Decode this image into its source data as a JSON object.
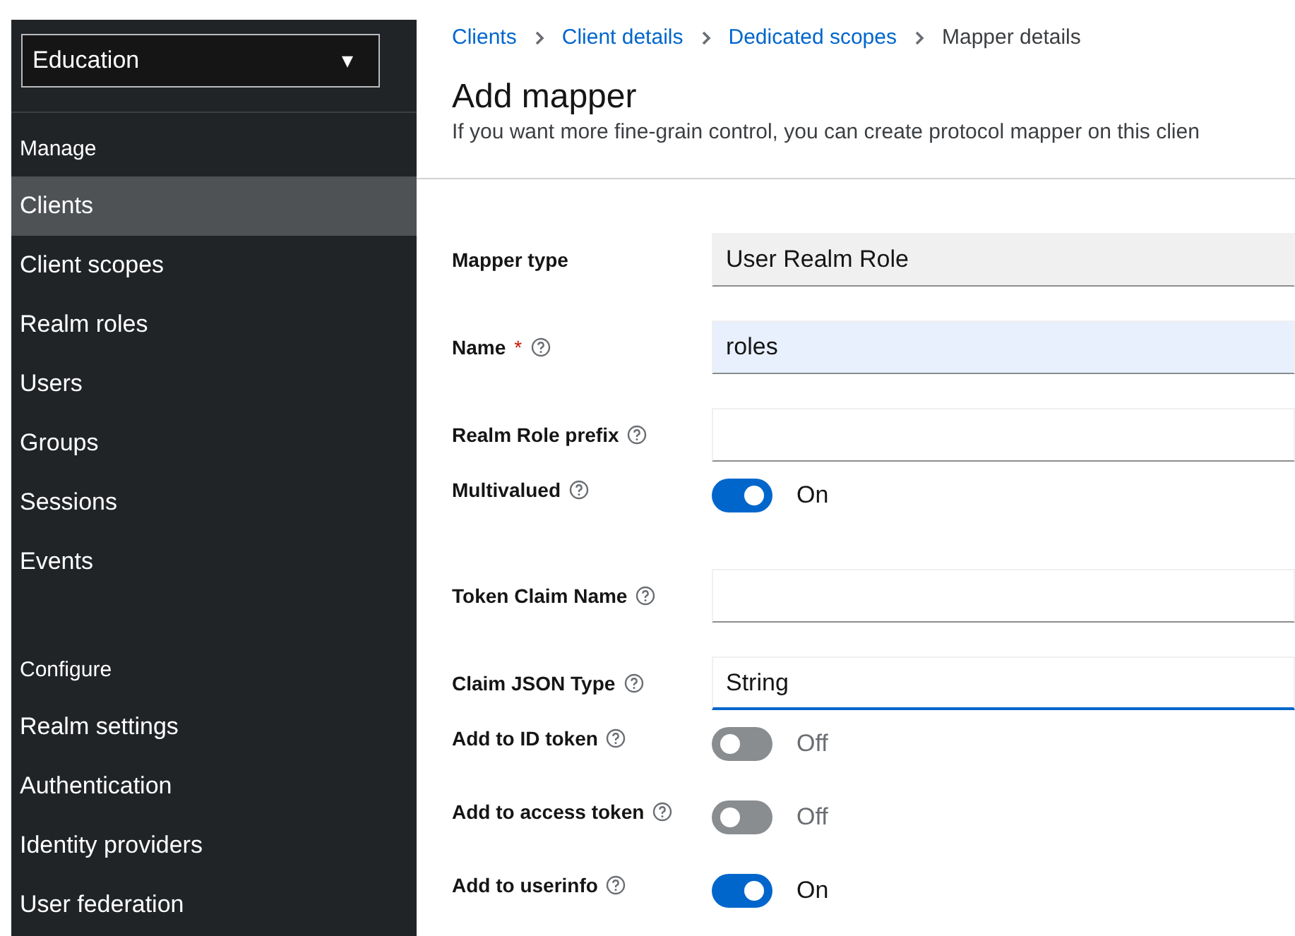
{
  "sidebar": {
    "realm_selector": {
      "value": "Education",
      "caret": "▾"
    },
    "sections": [
      {
        "title": "Manage",
        "items": [
          {
            "label": "Clients",
            "selected": true
          },
          {
            "label": "Client scopes",
            "selected": false
          },
          {
            "label": "Realm roles",
            "selected": false
          },
          {
            "label": "Users",
            "selected": false
          },
          {
            "label": "Groups",
            "selected": false
          },
          {
            "label": "Sessions",
            "selected": false
          },
          {
            "label": "Events",
            "selected": false
          }
        ]
      },
      {
        "title": "Configure",
        "items": [
          {
            "label": "Realm settings",
            "selected": false
          },
          {
            "label": "Authentication",
            "selected": false
          },
          {
            "label": "Identity providers",
            "selected": false
          },
          {
            "label": "User federation",
            "selected": false
          }
        ]
      }
    ]
  },
  "breadcrumbs": [
    {
      "label": "Clients",
      "current": false
    },
    {
      "label": "Client details",
      "current": false
    },
    {
      "label": "Dedicated scopes",
      "current": false
    },
    {
      "label": "Mapper details",
      "current": true
    }
  ],
  "page": {
    "title": "Add mapper",
    "description": "If you want more fine-grain control, you can create protocol mapper on this clien"
  },
  "form": [
    {
      "kind": "readonly",
      "label": "Mapper type",
      "value": "User Realm Role",
      "help": false,
      "required": false
    },
    {
      "kind": "text",
      "label": "Name",
      "value": "roles",
      "help": true,
      "required": true,
      "required_mark": "*",
      "autofilled": true
    },
    {
      "kind": "text",
      "label": "Realm Role prefix",
      "help": true,
      "required": false,
      "autofilled": false
    },
    {
      "kind": "toggle",
      "label": "Multivalued",
      "on": true,
      "state_text": "On",
      "help": true,
      "required": false
    },
    {
      "kind": "text",
      "label": "Token Claim Name",
      "help": true,
      "required": false,
      "autofilled": false
    },
    {
      "kind": "select",
      "label": "Claim JSON Type",
      "value": "String",
      "help": true,
      "required": false,
      "focused": true
    },
    {
      "kind": "toggle",
      "label": "Add to ID token",
      "on": false,
      "state_text": "Off",
      "help": true,
      "required": false
    },
    {
      "kind": "toggle",
      "label": "Add to access token",
      "on": false,
      "state_text": "Off",
      "help": true,
      "required": false
    },
    {
      "kind": "toggle",
      "label": "Add to userinfo",
      "on": true,
      "state_text": "On",
      "help": true,
      "required": false
    }
  ]
}
